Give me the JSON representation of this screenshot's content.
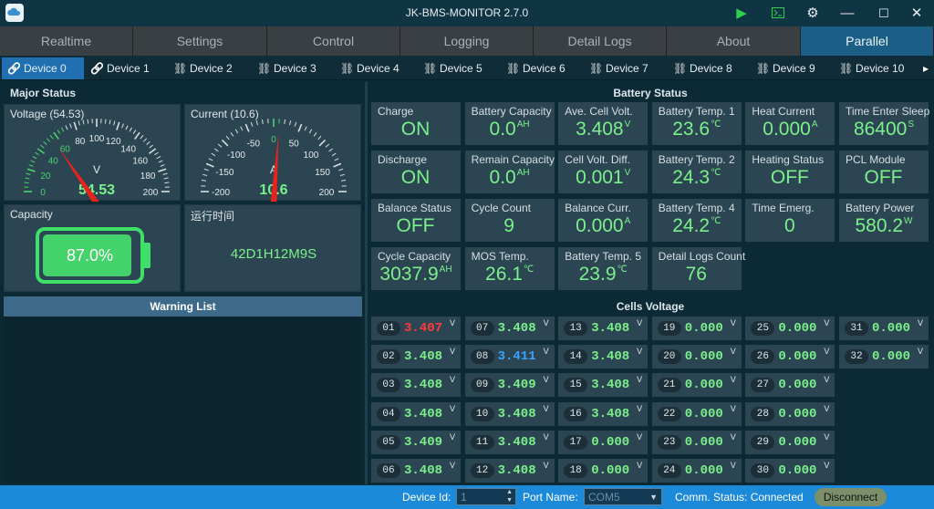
{
  "window": {
    "title": "JK-BMS-MONITOR 2.7.0",
    "logo_icon": "cloud-icon",
    "controls": {
      "play": "▶",
      "terminal": "⌨",
      "settings": "⚙",
      "minimize": "—",
      "maximize": "☐",
      "close": "✕"
    }
  },
  "main_tabs": [
    "Realtime",
    "Settings",
    "Control",
    "Logging",
    "Detail Logs",
    "About",
    "Parallel"
  ],
  "active_main_tab": "Parallel",
  "device_tabs": [
    "Device 0",
    "Device 1",
    "Device 2",
    "Device 3",
    "Device 4",
    "Device 5",
    "Device 6",
    "Device 7",
    "Device 8",
    "Device 9",
    "Device 10"
  ],
  "device_more": "▸",
  "major_status": {
    "title": "Major Status",
    "voltage_gauge": {
      "label": "Voltage (54.53)",
      "value": 54.53,
      "display": "54.53",
      "unit": "V",
      "min": 0,
      "max": 200,
      "ticks": [
        "0",
        "20",
        "40",
        "60",
        "80",
        "100",
        "120",
        "140",
        "160",
        "180",
        "200"
      ]
    },
    "current_gauge": {
      "label": "Current (10.6)",
      "value": 10.6,
      "display": "10.6",
      "unit": "A",
      "min": -200,
      "max": 200,
      "ticks": [
        "-200",
        "-150",
        "-100",
        "-50",
        "0",
        "50",
        "100",
        "150",
        "200"
      ]
    },
    "capacity": {
      "label": "Capacity",
      "percent": "87.0%",
      "level": 0.87
    },
    "runtime": {
      "label": "运行时间",
      "value": "42D1H12M9S"
    }
  },
  "warning_list": {
    "title": "Warning List"
  },
  "battery_status": {
    "title": "Battery Status",
    "cells": [
      {
        "label": "Charge",
        "value": "ON",
        "unit": ""
      },
      {
        "label": "Battery Capacity",
        "value": "0.0",
        "unit": "AH"
      },
      {
        "label": "Ave. Cell Volt.",
        "value": "3.408",
        "unit": "V"
      },
      {
        "label": "Battery Temp. 1",
        "value": "23.6",
        "unit": "℃"
      },
      {
        "label": "Heat Current",
        "value": "0.000",
        "unit": "A"
      },
      {
        "label": "Time Enter Sleep",
        "value": "86400",
        "unit": "S"
      },
      {
        "label": "Discharge",
        "value": "ON",
        "unit": ""
      },
      {
        "label": "Remain Capacity",
        "value": "0.0",
        "unit": "AH"
      },
      {
        "label": "Cell Volt. Diff.",
        "value": "0.001",
        "unit": "V"
      },
      {
        "label": "Battery Temp. 2",
        "value": "24.3",
        "unit": "℃"
      },
      {
        "label": "Heating Status",
        "value": "OFF",
        "unit": ""
      },
      {
        "label": "PCL Module",
        "value": "OFF",
        "unit": ""
      },
      {
        "label": "Balance Status",
        "value": "OFF",
        "unit": ""
      },
      {
        "label": "Cycle Count",
        "value": "9",
        "unit": ""
      },
      {
        "label": "Balance Curr.",
        "value": "0.000",
        "unit": "A"
      },
      {
        "label": "Battery Temp. 4",
        "value": "24.2",
        "unit": "℃"
      },
      {
        "label": "Time Emerg.",
        "value": "0",
        "unit": ""
      },
      {
        "label": "Battery Power",
        "value": "580.2",
        "unit": "W"
      },
      {
        "label": "Cycle Capacity",
        "value": "3037.9",
        "unit": "AH"
      },
      {
        "label": "MOS Temp.",
        "value": "26.1",
        "unit": "℃"
      },
      {
        "label": "Battery Temp. 5",
        "value": "23.9",
        "unit": "℃"
      },
      {
        "label": "Detail Logs Count",
        "value": "76",
        "unit": ""
      }
    ]
  },
  "cells_voltage": {
    "title": "Cells Voltage",
    "unit": "V",
    "colors": {
      "normal": "#7cf08a",
      "max": "#ff3b3b",
      "min": "#3aa3ff"
    },
    "cells": [
      {
        "num": "01",
        "v": "3.407",
        "state": "max"
      },
      {
        "num": "02",
        "v": "3.408",
        "state": "normal"
      },
      {
        "num": "03",
        "v": "3.408",
        "state": "normal"
      },
      {
        "num": "04",
        "v": "3.408",
        "state": "normal"
      },
      {
        "num": "05",
        "v": "3.409",
        "state": "normal"
      },
      {
        "num": "06",
        "v": "3.408",
        "state": "normal"
      },
      {
        "num": "07",
        "v": "3.408",
        "state": "normal"
      },
      {
        "num": "08",
        "v": "3.411",
        "state": "min"
      },
      {
        "num": "09",
        "v": "3.409",
        "state": "normal"
      },
      {
        "num": "10",
        "v": "3.408",
        "state": "normal"
      },
      {
        "num": "11",
        "v": "3.408",
        "state": "normal"
      },
      {
        "num": "12",
        "v": "3.408",
        "state": "normal"
      },
      {
        "num": "13",
        "v": "3.408",
        "state": "normal"
      },
      {
        "num": "14",
        "v": "3.408",
        "state": "normal"
      },
      {
        "num": "15",
        "v": "3.408",
        "state": "normal"
      },
      {
        "num": "16",
        "v": "3.408",
        "state": "normal"
      },
      {
        "num": "17",
        "v": "0.000",
        "state": "normal"
      },
      {
        "num": "18",
        "v": "0.000",
        "state": "normal"
      },
      {
        "num": "19",
        "v": "0.000",
        "state": "normal"
      },
      {
        "num": "20",
        "v": "0.000",
        "state": "normal"
      },
      {
        "num": "21",
        "v": "0.000",
        "state": "normal"
      },
      {
        "num": "22",
        "v": "0.000",
        "state": "normal"
      },
      {
        "num": "23",
        "v": "0.000",
        "state": "normal"
      },
      {
        "num": "24",
        "v": "0.000",
        "state": "normal"
      },
      {
        "num": "25",
        "v": "0.000",
        "state": "normal"
      },
      {
        "num": "26",
        "v": "0.000",
        "state": "normal"
      },
      {
        "num": "27",
        "v": "0.000",
        "state": "normal"
      },
      {
        "num": "28",
        "v": "0.000",
        "state": "normal"
      },
      {
        "num": "29",
        "v": "0.000",
        "state": "normal"
      },
      {
        "num": "30",
        "v": "0.000",
        "state": "normal"
      },
      {
        "num": "31",
        "v": "0.000",
        "state": "normal"
      },
      {
        "num": "32",
        "v": "0.000",
        "state": "normal"
      }
    ]
  },
  "status_bar": {
    "device_id_label": "Device Id:",
    "device_id_value": "1",
    "port_label": "Port Name:",
    "port_value": "COM5",
    "comm_status": "Comm. Status: Connected",
    "disconnect_label": "Disconnect"
  },
  "colors": {
    "accent": "#1b5f86",
    "value_green": "#7cf08a",
    "statusbar": "#1c8ad8",
    "needle": "#e8231c"
  }
}
